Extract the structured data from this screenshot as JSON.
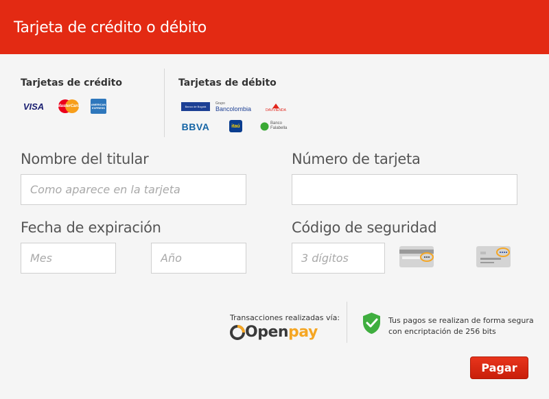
{
  "header": {
    "title": "Tarjeta de crédito o débito"
  },
  "credit": {
    "title": "Tarjetas de crédito",
    "logos": [
      {
        "name": "visa",
        "text": "VISA",
        "color": "#1a1f71"
      },
      {
        "name": "mastercard",
        "text": "MasterCard",
        "color": "#eb001b"
      },
      {
        "name": "amex",
        "text": "AMERICAN EXPRESS",
        "color": "#2e77bc"
      }
    ]
  },
  "debit": {
    "title": "Tarjetas de débito",
    "logos": [
      {
        "name": "banco-de-bogota",
        "text": "Banco de Bogotá",
        "color": "#1c3f94"
      },
      {
        "name": "bancolombia",
        "text_top": "Grupo",
        "text": "Bancolombia",
        "color": "#1c3f94"
      },
      {
        "name": "davivienda",
        "text": "DAVIVIENDA",
        "color": "#e1251b"
      },
      {
        "name": "bbva",
        "text": "BBVA",
        "color": "#1464a5"
      },
      {
        "name": "itau",
        "text": "itaú",
        "color": "#0a3d8f"
      },
      {
        "name": "banco-falabella",
        "text_top": "Banco",
        "text": "Falabella",
        "color": "#3aa935"
      }
    ]
  },
  "form": {
    "holder_label": "Nombre del titular",
    "holder_placeholder": "Como aparece en la tarjeta",
    "number_label": "Número de tarjeta",
    "number_placeholder": "",
    "expiry_label": "Fecha de expiración",
    "month_placeholder": "Mes",
    "year_placeholder": "Año",
    "cvv_label": "Código de seguridad",
    "cvv_placeholder": "3 dígitos"
  },
  "footer": {
    "transactions_label": "Transacciones realizadas vía:",
    "openpay_open": "Open",
    "openpay_pay": "pay",
    "secure_line1": "Tus pagos se realizan de forma segura",
    "secure_line2": "con encriptación de 256 bits",
    "pay_button": "Pagar"
  },
  "colors": {
    "header": "#e32a13",
    "button": "#d42812",
    "shield": "#3fae3f",
    "openpay_dark": "#3a3a3a",
    "openpay_accent": "#f5a623"
  }
}
